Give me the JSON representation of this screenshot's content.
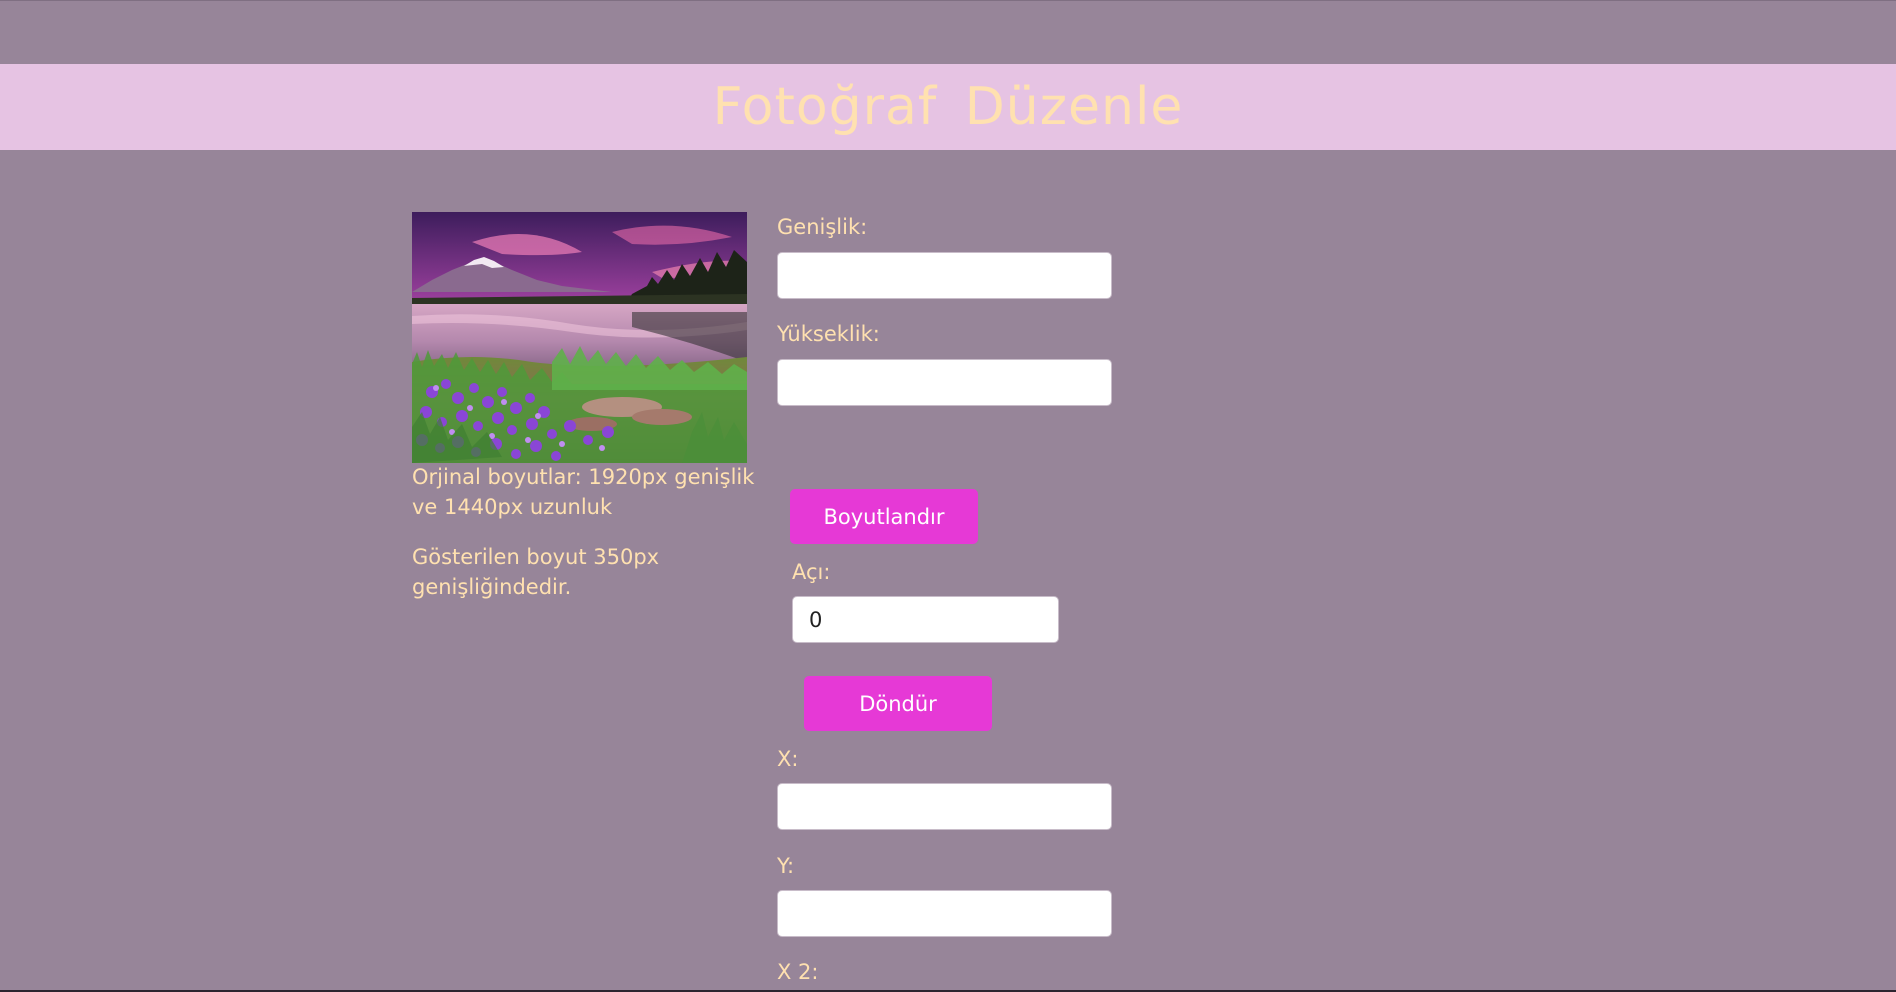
{
  "header": {
    "title": "Fotoğraf Düzenle"
  },
  "image_panel": {
    "original_size_text": "Orjinal boyutlar: 1920px genişlik ve 1440px uzunluk",
    "display_size_text": "Gösterilen boyut 350px genişliğindedir."
  },
  "resize": {
    "width_label": "Genişlik:",
    "width_value": "",
    "height_label": "Yükseklik:",
    "height_value": "",
    "button_label": "Boyutlandır"
  },
  "rotate": {
    "angle_label": "Açı:",
    "angle_value": "0",
    "button_label": "Döndür"
  },
  "crop": {
    "x_label": "X:",
    "x_value": "",
    "y_label": "Y:",
    "y_value": "",
    "x2_label": "X 2:"
  },
  "colors": {
    "background": "#978599",
    "header_bg": "#e6c3e3",
    "text": "#ffe1b0",
    "button": "#e639d6"
  }
}
